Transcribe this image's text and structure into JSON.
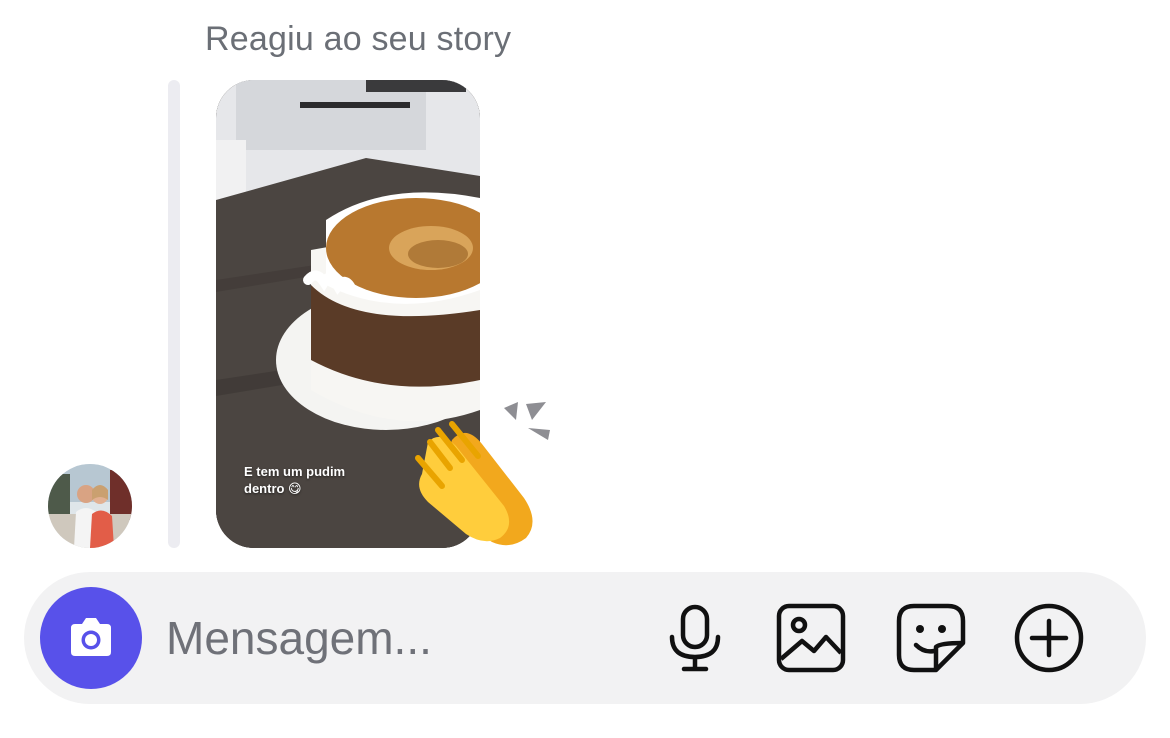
{
  "thread": {
    "reaction_caption": "Reagiu ao seu story",
    "story": {
      "caption_line1": "E tem um pudim",
      "caption_line2": "dentro 😋",
      "reaction_emoji": "clapping-hands"
    },
    "avatar_icon": "user-avatar-photo"
  },
  "composer": {
    "placeholder": "Mensagem...",
    "value": "",
    "camera_icon": "camera-icon",
    "microphone_icon": "microphone-icon",
    "gallery_icon": "image-gallery-icon",
    "sticker_icon": "sticker-icon",
    "more_icon": "plus-circle-icon"
  },
  "colors": {
    "accent": "#5851ea",
    "caption_gray": "#6b6f76",
    "composer_bg": "#f2f2f3",
    "reply_bar": "#ececf1"
  }
}
